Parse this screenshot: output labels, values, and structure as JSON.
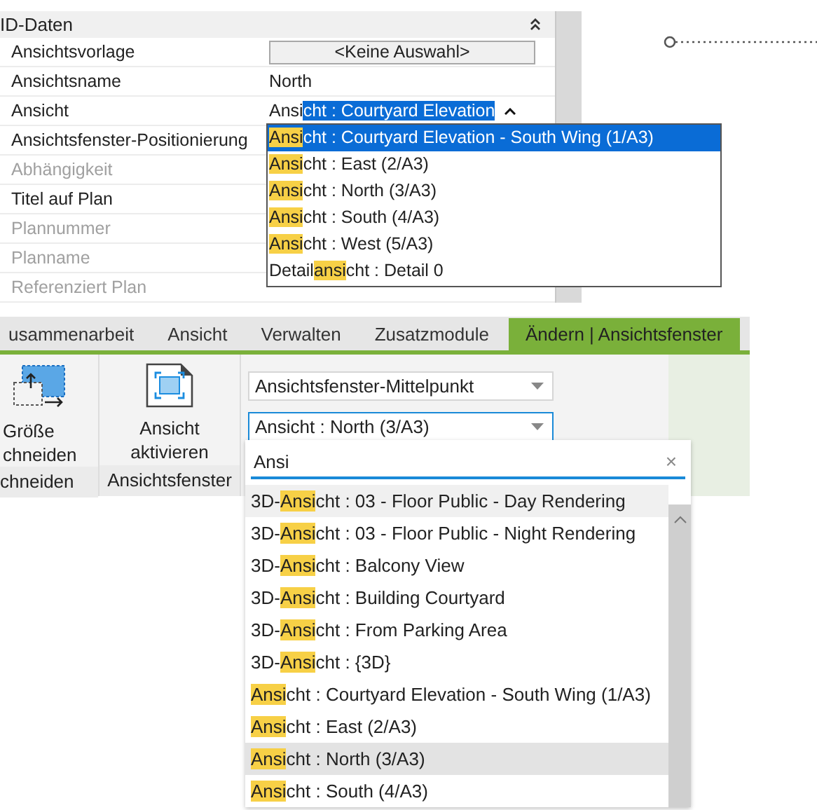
{
  "properties": {
    "header": "ID-Daten",
    "rows": [
      {
        "label": "Ansichtsvorlage",
        "disabled": false,
        "kind": "button",
        "value": "<Keine Auswahl>"
      },
      {
        "label": "Ansichtsname",
        "disabled": false,
        "kind": "text",
        "value": "North"
      },
      {
        "label": "Ansicht",
        "disabled": false,
        "kind": "combo",
        "before": "Ansi",
        "selected_text": "cht : Courtyard Elevation"
      },
      {
        "label": "Ansichtsfenster-Positionierung",
        "disabled": false,
        "kind": "empty"
      },
      {
        "label": "Abhängigkeit",
        "disabled": true,
        "kind": "empty"
      },
      {
        "label": "Titel auf Plan",
        "disabled": false,
        "kind": "empty"
      },
      {
        "label": "Plannummer",
        "disabled": true,
        "kind": "empty"
      },
      {
        "label": "Planname",
        "disabled": true,
        "kind": "empty"
      },
      {
        "label": "Referenziert Plan",
        "disabled": true,
        "kind": "empty"
      }
    ],
    "dropdown": [
      {
        "match": "Ansi",
        "after": "cht : Courtyard Elevation - South Wing (1/A3)",
        "selected": true
      },
      {
        "match": "Ansi",
        "after": "cht : East (2/A3)",
        "selected": false
      },
      {
        "match": "Ansi",
        "after": "cht : North (3/A3)",
        "selected": false
      },
      {
        "match": "Ansi",
        "after": "cht : South (4/A3)",
        "selected": false
      },
      {
        "match": "Ansi",
        "after": "cht : West (5/A3)",
        "selected": false
      },
      {
        "before": "Detail",
        "match": "ansi",
        "after": "cht : Detail 0",
        "selected": false
      }
    ]
  },
  "ribbon": {
    "tabs": [
      {
        "label": "usammenarbeit",
        "selected": false
      },
      {
        "label": "Ansicht",
        "selected": false
      },
      {
        "label": "Verwalten",
        "selected": false
      },
      {
        "label": "Zusatzmodule",
        "selected": false
      },
      {
        "label": "Ändern | Ansichtsfenster",
        "selected": true
      }
    ],
    "groups": [
      {
        "tool": "Größe\nchneiden",
        "label": "chneiden"
      },
      {
        "tool": "Ansicht\naktivieren",
        "label": "Ansichtsfenster"
      }
    ],
    "dropdowns": [
      {
        "value": "Ansichtsfenster-Mittelpunkt"
      },
      {
        "value": "Ansicht : North (3/A3)"
      }
    ],
    "search": {
      "value": "Ansi",
      "clear": "×"
    },
    "list": [
      {
        "before": "3D-",
        "match": "Ansi",
        "after": "cht : 03 - Floor Public - Day Rendering",
        "selected": false,
        "hover": true
      },
      {
        "before": "3D-",
        "match": "Ansi",
        "after": "cht : 03 - Floor Public - Night Rendering",
        "selected": false,
        "hover": false
      },
      {
        "before": "3D-",
        "match": "Ansi",
        "after": "cht : Balcony View",
        "selected": false,
        "hover": false
      },
      {
        "before": "3D-",
        "match": "Ansi",
        "after": "cht : Building Courtyard",
        "selected": false,
        "hover": false
      },
      {
        "before": "3D-",
        "match": "Ansi",
        "after": "cht : From Parking Area",
        "selected": false,
        "hover": false
      },
      {
        "before": "3D-",
        "match": "Ansi",
        "after": "cht : {3D}",
        "selected": false,
        "hover": false
      },
      {
        "match": "Ansi",
        "after": "cht : Courtyard Elevation - South Wing (1/A3)",
        "selected": false,
        "hover": false
      },
      {
        "match": "Ansi",
        "after": "cht : East (2/A3)",
        "selected": false,
        "hover": false
      },
      {
        "match": "Ansi",
        "after": "cht : North (3/A3)",
        "selected": true,
        "hover": false
      },
      {
        "match": "Ansi",
        "after": "cht : South (4/A3)",
        "selected": false,
        "hover": false
      }
    ]
  }
}
